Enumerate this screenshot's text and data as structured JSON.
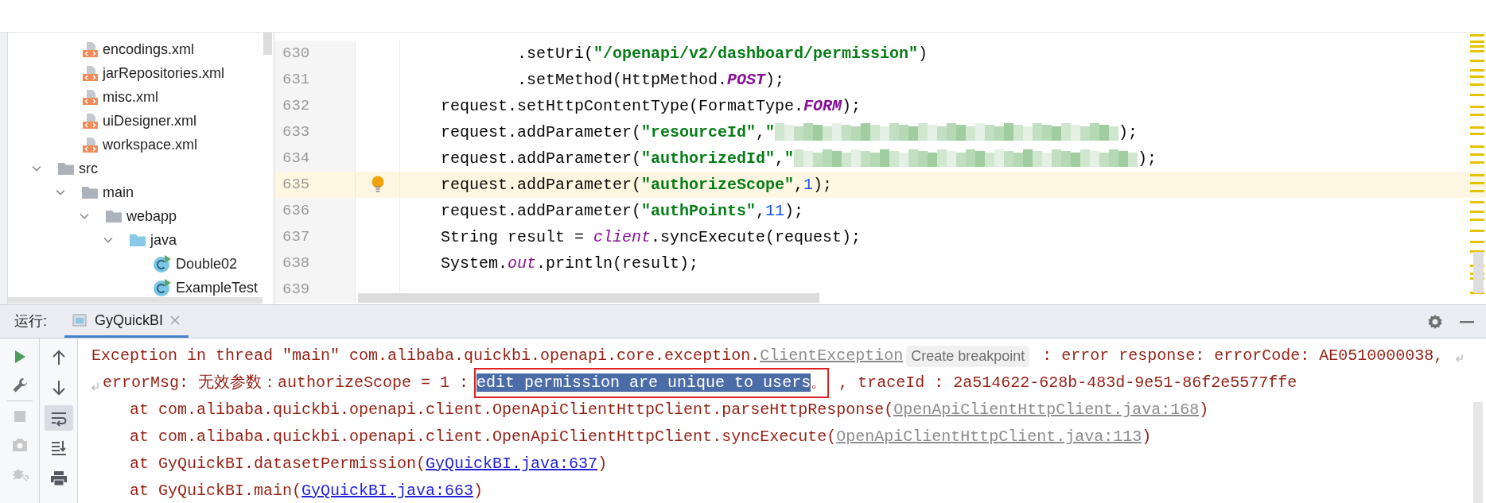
{
  "project_tree": {
    "children_of_scrolled_folder": [
      {
        "name": "encodings.xml",
        "kind": "xml"
      },
      {
        "name": "jarRepositories.xml",
        "kind": "xml"
      },
      {
        "name": "misc.xml",
        "kind": "xml"
      },
      {
        "name": "uiDesigner.xml",
        "kind": "xml"
      },
      {
        "name": "workspace.xml",
        "kind": "xml"
      }
    ],
    "items": [
      {
        "name": "src",
        "kind": "folder",
        "expanded": true,
        "children": [
          {
            "name": "main",
            "kind": "folder",
            "expanded": true,
            "children": [
              {
                "name": "webapp",
                "kind": "folder",
                "expanded": true,
                "children": [
                  {
                    "name": "java",
                    "kind": "source_folder",
                    "expanded": true,
                    "children": [
                      {
                        "name": "Double02",
                        "kind": "class"
                      },
                      {
                        "name": "ExampleTest",
                        "kind": "class"
                      }
                    ]
                  }
                ]
              }
            ]
          }
        ]
      }
    ]
  },
  "editor": {
    "lines": [
      {
        "number": "630",
        "current": false,
        "bulb": false,
        "tokens": [
          {
            "kind": "plain",
            "s": "        .setUri("
          },
          {
            "kind": "string",
            "s": "\"/openapi/v2/dashboard/permission\""
          },
          {
            "kind": "plain",
            "s": ")"
          }
        ]
      },
      {
        "number": "631",
        "current": false,
        "bulb": false,
        "tokens": [
          {
            "kind": "plain",
            "s": "        .setMethod(HttpMethod."
          },
          {
            "kind": "constant",
            "s": "POST"
          },
          {
            "kind": "plain",
            "s": ");"
          }
        ]
      },
      {
        "number": "632",
        "current": false,
        "bulb": false,
        "tokens": [
          {
            "kind": "plain",
            "s": "request.setHttpContentType(FormatType."
          },
          {
            "kind": "constant",
            "s": "FORM"
          },
          {
            "kind": "plain",
            "s": ");"
          }
        ]
      },
      {
        "number": "633",
        "current": false,
        "bulb": false,
        "tokens": [
          {
            "kind": "plain",
            "s": "request.addParameter("
          },
          {
            "kind": "string",
            "s": "\"resourceId\""
          },
          {
            "kind": "plain",
            "s": ","
          },
          {
            "kind": "string",
            "s": "\""
          },
          {
            "kind": "redacted"
          },
          {
            "kind": "plain",
            "s": ");"
          }
        ]
      },
      {
        "number": "634",
        "current": false,
        "bulb": false,
        "tokens": [
          {
            "kind": "plain",
            "s": "request.addParameter("
          },
          {
            "kind": "string",
            "s": "\"authorizedId\""
          },
          {
            "kind": "plain",
            "s": ","
          },
          {
            "kind": "string",
            "s": "\""
          },
          {
            "kind": "redacted"
          },
          {
            "kind": "plain",
            "s": ");"
          }
        ]
      },
      {
        "number": "635",
        "current": true,
        "bulb": true,
        "tokens": [
          {
            "kind": "plain",
            "s": "request.addParameter("
          },
          {
            "kind": "string",
            "s": "\"authorizeScope\""
          },
          {
            "kind": "plain",
            "s": ","
          },
          {
            "kind": "number",
            "s": "1"
          },
          {
            "kind": "plain",
            "s": ");"
          }
        ]
      },
      {
        "number": "636",
        "current": false,
        "bulb": false,
        "tokens": [
          {
            "kind": "plain",
            "s": "request.addParameter("
          },
          {
            "kind": "string",
            "s": "\"authPoints\""
          },
          {
            "kind": "plain",
            "s": ","
          },
          {
            "kind": "number",
            "s": "11"
          },
          {
            "kind": "plain",
            "s": ");"
          }
        ]
      },
      {
        "number": "637",
        "current": false,
        "bulb": false,
        "tokens": [
          {
            "kind": "plain",
            "s": "String result = "
          },
          {
            "kind": "field",
            "s": "client"
          },
          {
            "kind": "plain",
            "s": ".syncExecute(request);"
          }
        ]
      },
      {
        "number": "638",
        "current": false,
        "bulb": false,
        "tokens": [
          {
            "kind": "plain",
            "s": "System."
          },
          {
            "kind": "field",
            "s": "out"
          },
          {
            "kind": "plain",
            "s": ".println(result);"
          }
        ]
      },
      {
        "number": "639",
        "current": false
      }
    ]
  },
  "run_panel": {
    "label": "运行:",
    "tabs": [
      {
        "label": "GyQuickBI",
        "selected": true
      }
    ],
    "run_tools": [
      {
        "kind": "rerun",
        "disabled": false
      },
      {
        "kind": "settings",
        "disabled": false
      },
      {
        "kind": "stop",
        "disabled": true
      },
      {
        "kind": "screenshot",
        "disabled": true
      },
      {
        "kind": "debug",
        "disabled": true
      }
    ],
    "output_tools": [
      {
        "kind": "up",
        "selected": false
      },
      {
        "kind": "down",
        "selected": false
      },
      {
        "kind": "soft_wrap",
        "selected": true
      },
      {
        "kind": "scroll_end",
        "selected": false
      },
      {
        "kind": "print",
        "selected": false
      }
    ],
    "output": [
      {
        "wrap_start": false,
        "wrap_end": true,
        "tokens": [
          {
            "kind": "error",
            "s": "Exception in thread \"main\" com.alibaba.quickbi.openapi.core.exception."
          },
          {
            "kind": "link_gray",
            "s": "ClientException"
          },
          {
            "kind": "hint",
            "s": "Create breakpoint"
          },
          {
            "kind": "error",
            "s": " : error response: errorCode: AE0510000038,"
          }
        ]
      },
      {
        "wrap_start": true,
        "wrap_end": false,
        "tokens": [
          {
            "kind": "error",
            "s": "errorMsg: 无效参数：authorizeScope = 1 : "
          },
          {
            "kind": "selected",
            "s": "edit permission are unique to users",
            "boxed": true
          },
          {
            "kind": "error",
            "s": "。",
            "boxed": true
          },
          {
            "kind": "error",
            "s": " , traceId : 2a514622-628b-483d-9e51-86f2e5577ffe"
          }
        ]
      },
      {
        "wrap_start": false,
        "wrap_end": false,
        "tokens": [
          {
            "kind": "error",
            "s": "    at com.alibaba.quickbi.openapi.client.OpenApiClientHttpClient.parseHttpResponse("
          },
          {
            "kind": "link_gray",
            "s": "OpenApiClientHttpClient.java:168"
          },
          {
            "kind": "error",
            "s": ")"
          }
        ]
      },
      {
        "wrap_start": false,
        "wrap_end": false,
        "tokens": [
          {
            "kind": "error",
            "s": "    at com.alibaba.quickbi.openapi.client.OpenApiClientHttpClient.syncExecute("
          },
          {
            "kind": "link_gray",
            "s": "OpenApiClientHttpClient.java:113"
          },
          {
            "kind": "error",
            "s": ")"
          }
        ]
      },
      {
        "wrap_start": false,
        "wrap_end": false,
        "tokens": [
          {
            "kind": "error",
            "s": "    at GyQuickBI.datasetPermission("
          },
          {
            "kind": "link",
            "s": "GyQuickBI.java:637"
          },
          {
            "kind": "error",
            "s": ")"
          }
        ]
      },
      {
        "wrap_start": false,
        "wrap_end": false,
        "tokens": [
          {
            "kind": "error",
            "s": "    at GyQuickBI.main("
          },
          {
            "kind": "link",
            "s": "GyQuickBI.java:663"
          },
          {
            "kind": "error",
            "s": ")"
          }
        ]
      }
    ]
  }
}
